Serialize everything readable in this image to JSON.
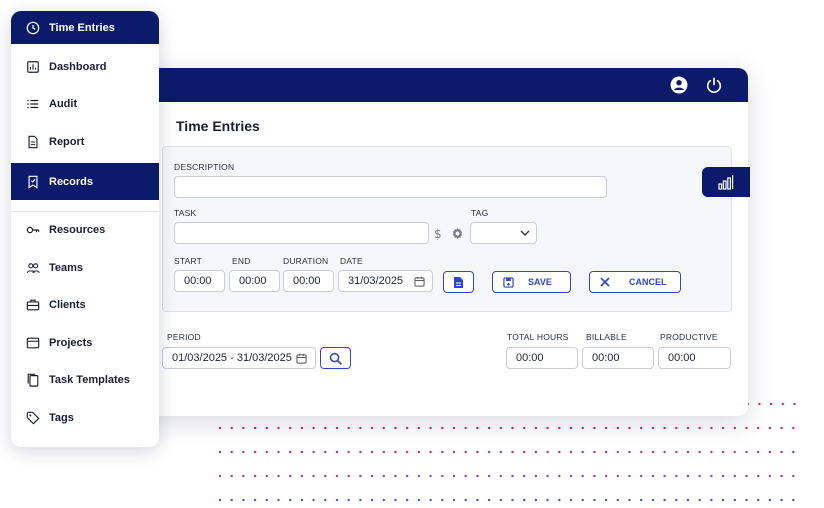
{
  "sidebar": {
    "items": [
      {
        "label": "Time Entries",
        "icon": "clock-icon",
        "active": true
      },
      {
        "label": "Dashboard",
        "icon": "dashboard-icon"
      },
      {
        "label": "Audit",
        "icon": "list-icon"
      },
      {
        "label": "Report",
        "icon": "document-icon"
      },
      {
        "label": "Records",
        "icon": "bookmark-icon",
        "active": true
      },
      {
        "label": "Resources",
        "icon": "key-icon"
      },
      {
        "label": "Teams",
        "icon": "team-icon"
      },
      {
        "label": "Clients",
        "icon": "briefcase-icon"
      },
      {
        "label": "Projects",
        "icon": "folder-icon"
      },
      {
        "label": "Task Templates",
        "icon": "copy-icon"
      },
      {
        "label": "Tags",
        "icon": "tag-icon"
      }
    ]
  },
  "header": {
    "user_icon": "user-circle-icon",
    "power_icon": "power-icon"
  },
  "main": {
    "title": "Time Entries",
    "form": {
      "description_label": "DESCRIPTION",
      "description_value": "",
      "task_label": "TASK",
      "task_value": "",
      "tag_label": "TAG",
      "tag_value": "",
      "start_label": "START",
      "start_value": "00:00",
      "end_label": "END",
      "end_value": "00:00",
      "duration_label": "DURATION",
      "duration_value": "00:00",
      "date_label": "DATE",
      "date_value": "31/03/2025",
      "save_label": "SAVE",
      "cancel_label": "CANCEL"
    },
    "period": {
      "label": "PERIOD",
      "value": "01/03/2025 - 31/03/2025"
    },
    "totals": {
      "total_hours_label": "TOTAL HOURS",
      "total_hours_value": "00:00",
      "billable_label": "BILLABLE",
      "billable_value": "00:00",
      "productive_label": "PRODUCTIVE",
      "productive_value": "00:00"
    }
  },
  "colors": {
    "navy": "#0c1a6b",
    "accent_blue": "#2b4acb",
    "dot_red": "#e0245e",
    "dot_purple": "#8a3fd1",
    "dot_blue": "#3b5bdb"
  }
}
